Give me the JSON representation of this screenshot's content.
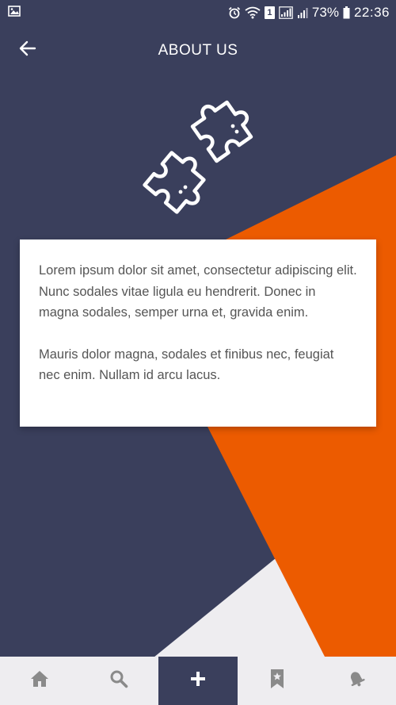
{
  "status_bar": {
    "battery_percent": "73%",
    "time": "22:36",
    "sim_badge": "1",
    "icons": [
      "image-notification-icon",
      "alarm-icon",
      "wifi-icon",
      "sim-icon",
      "signal-icon",
      "signal-icon",
      "battery-icon"
    ]
  },
  "header": {
    "title": "ABOUT US",
    "back_icon": "arrow-left-icon"
  },
  "hero": {
    "icon": "puzzle-pieces-icon"
  },
  "content": {
    "paragraphs": [
      "Lorem ipsum dolor sit amet, consectetur adipiscing elit. Nunc sodales vitae ligula eu hendrerit. Donec in magna sodales, semper urna et, gravida enim.",
      "Mauris dolor magna, sodales et finibus nec, feugiat nec enim. Nullam id arcu lacus."
    ]
  },
  "bottom_nav": {
    "items": [
      {
        "icon": "home-icon",
        "active": false
      },
      {
        "icon": "search-icon",
        "active": false
      },
      {
        "icon": "plus-icon",
        "active": true
      },
      {
        "icon": "bookmark-icon",
        "active": false
      },
      {
        "icon": "bell-icon",
        "active": false
      }
    ]
  },
  "colors": {
    "background": "#3a3f5c",
    "accent": "#ec5b00",
    "light_bg": "#eeedf0",
    "card": "#ffffff",
    "text": "#555555",
    "nav_icon": "#8a8a8a"
  }
}
